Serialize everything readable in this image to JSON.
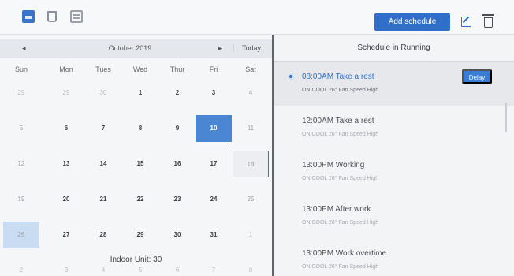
{
  "toolbar": {
    "add_label": "Add schedule",
    "icons": [
      "calendar-icon",
      "trash-icon",
      "list-icon",
      "edit-icon",
      "delete-icon"
    ]
  },
  "calendar": {
    "month": "October 2019",
    "prev": "◂",
    "next": "▸",
    "today": "Today",
    "weekdays": [
      "Sun",
      "Mon",
      "Tues",
      "Wed",
      "Thur",
      "Fri",
      "Sat"
    ],
    "weeks": [
      [
        "29",
        "29",
        "30",
        "1",
        "2",
        "3",
        "4"
      ],
      [
        "5",
        "6",
        "7",
        "8",
        "9",
        "10",
        "11"
      ],
      [
        "12",
        "13",
        "14",
        "15",
        "16",
        "17",
        "18"
      ],
      [
        "19",
        "20",
        "21",
        "22",
        "23",
        "24",
        "25"
      ],
      [
        "26",
        "27",
        "28",
        "29",
        "30",
        "31",
        "1"
      ],
      [
        "2",
        "3",
        "4",
        "5",
        "6",
        "7",
        "8"
      ]
    ],
    "selected": "10",
    "today_date": "18",
    "indoor_unit": "Indoor Unit: 30"
  },
  "schedule": {
    "title": "Schedule in Running",
    "delay_label": "Delay",
    "items": [
      {
        "title": "08:00AM Take a rest",
        "detail": "ON   COOL 26°   Fan Speed High"
      },
      {
        "title": "12:00AM Take a rest",
        "detail": "ON   COOL 26°   Fan Speed High"
      },
      {
        "title": "13:00PM Working",
        "detail": "ON   COOL 26°   Fan Speed High"
      },
      {
        "title": "13:00PM After work",
        "detail": "ON   COOL 26°   Fan Speed High"
      },
      {
        "title": "13:00PM Work overtime",
        "detail": "ON   COOL 26°   Fan Speed High"
      }
    ]
  },
  "colors": {
    "accent": "#2f6fc9",
    "selected": "#4a86d1",
    "divider": "#5d6470"
  }
}
